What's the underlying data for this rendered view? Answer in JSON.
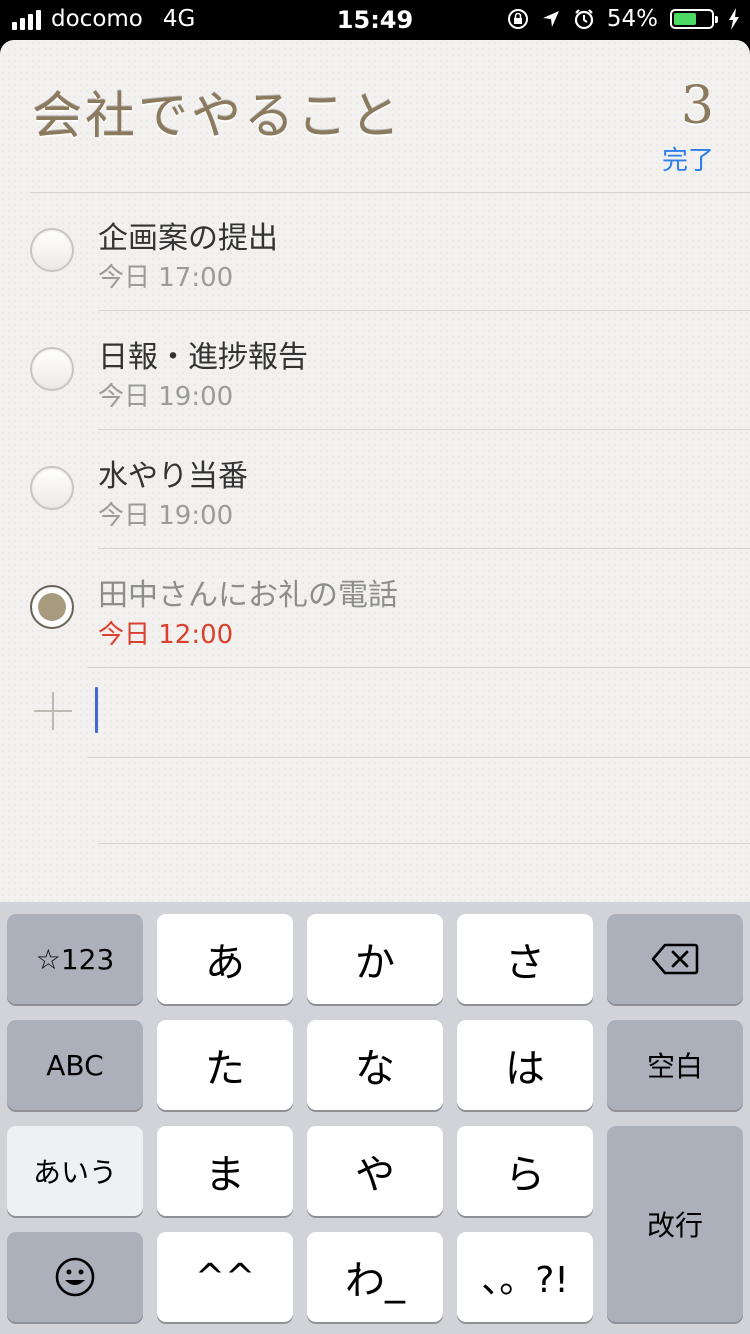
{
  "status_bar": {
    "carrier": "docomo",
    "network": "4G",
    "time": "15:49",
    "battery_percent": "54%",
    "battery_level": 0.54,
    "icons": [
      "orientation-lock-icon",
      "location-arrow-icon",
      "alarm-icon",
      "battery-icon",
      "charging-bolt-icon"
    ]
  },
  "list": {
    "title": "会社でやること",
    "count": "3",
    "done_button": "完了",
    "accent_color": "#2f7ee8",
    "title_color": "#8b7a5e"
  },
  "reminders": [
    {
      "title": "企画案の提出",
      "time": "今日 17:00",
      "completed": false,
      "overdue": false
    },
    {
      "title": "日報・進捗報告",
      "time": "今日 19:00",
      "completed": false,
      "overdue": false
    },
    {
      "title": "水やり当番",
      "time": "今日 19:00",
      "completed": false,
      "overdue": false
    },
    {
      "title": "田中さんにお礼の電話",
      "time": "今日 12:00",
      "completed": true,
      "overdue": true
    }
  ],
  "new_item": {
    "icon": "plus-icon",
    "value": ""
  },
  "keyboard": {
    "row1": {
      "left": "☆123",
      "keys": [
        "あ",
        "か",
        "さ"
      ],
      "right_icon": "backspace-icon"
    },
    "row2": {
      "left": "ABC",
      "keys": [
        "た",
        "な",
        "は"
      ],
      "right": "空白"
    },
    "row3": {
      "left": "あいう",
      "keys": [
        "ま",
        "や",
        "ら"
      ],
      "return": "改行"
    },
    "row4": {
      "left_icon": "emoji-icon",
      "keys": [
        "^^",
        "わ_",
        "、。?!"
      ]
    }
  }
}
